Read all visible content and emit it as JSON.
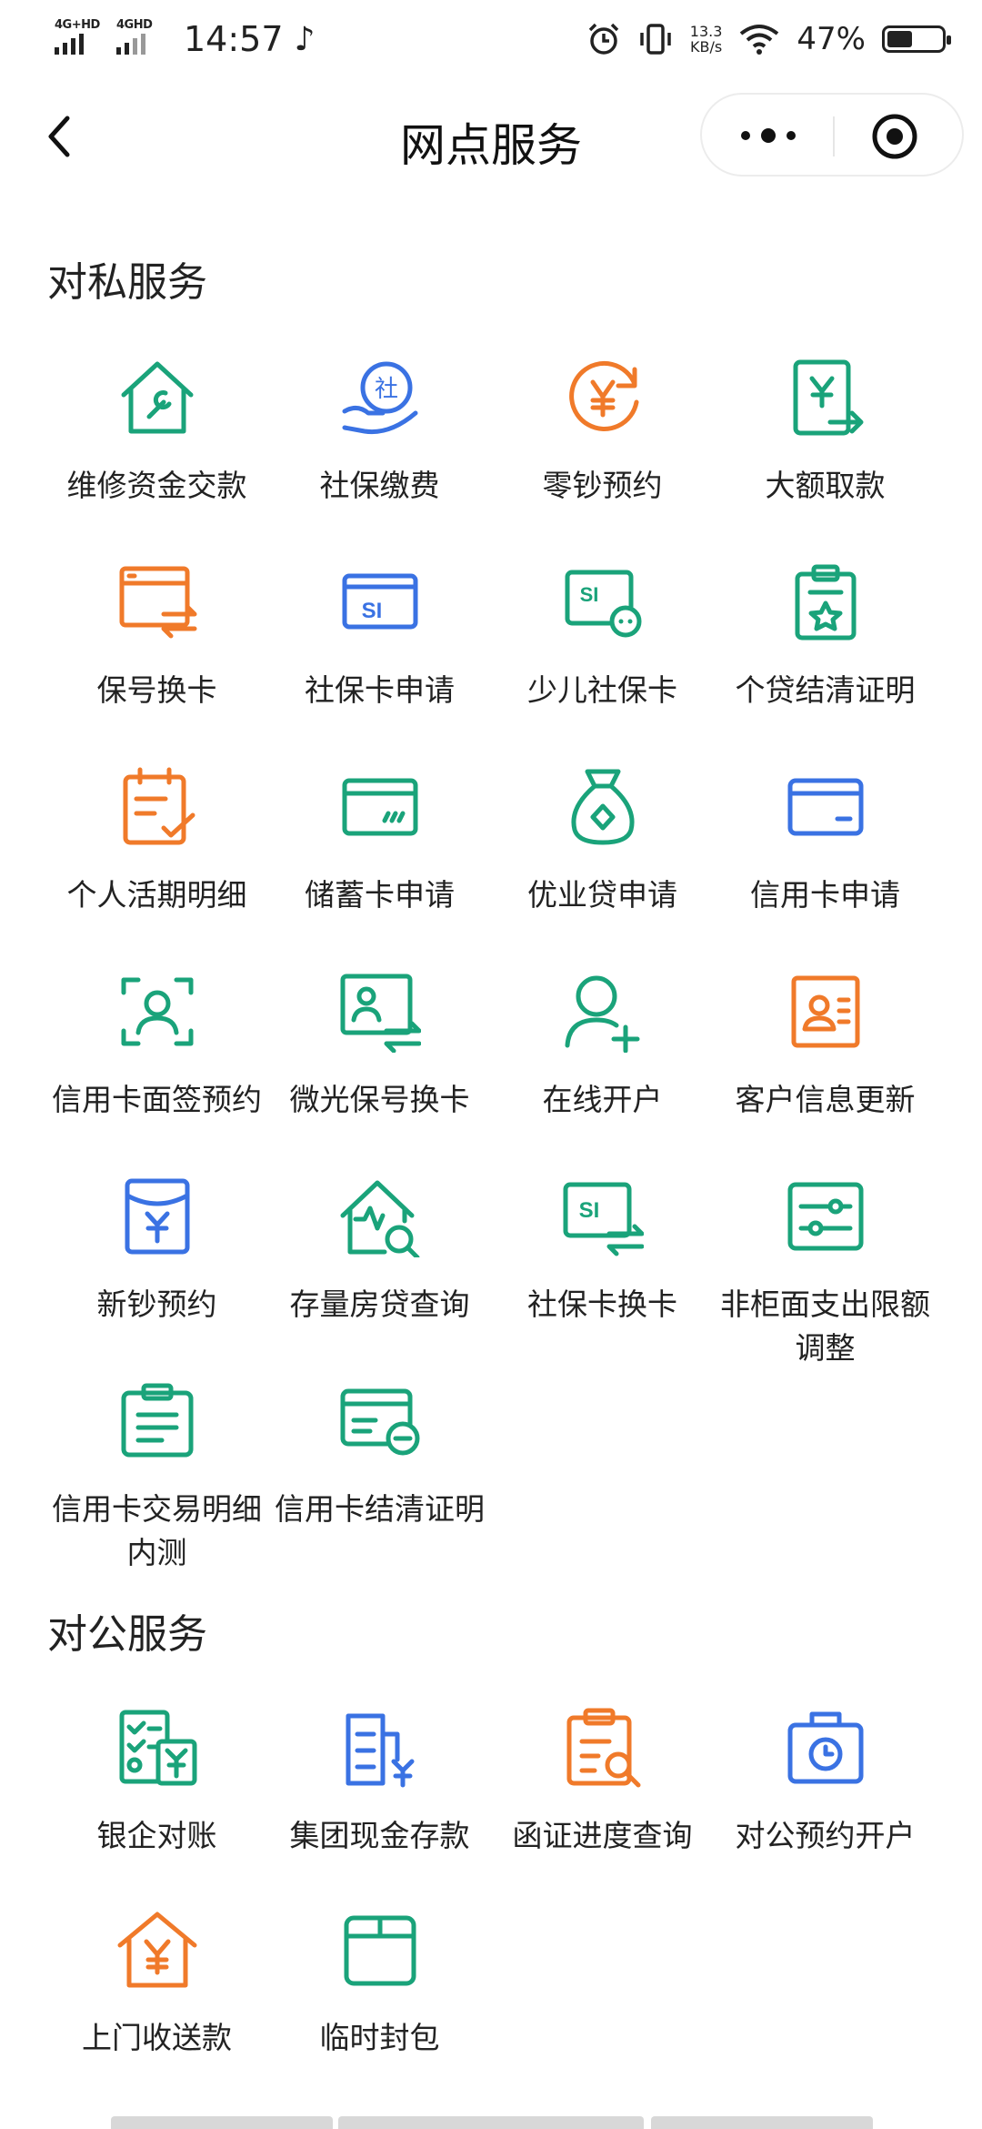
{
  "status_bar": {
    "network1": "4G+HD",
    "network2": "4GHD",
    "time": "14:57",
    "speed_value": "13.3",
    "speed_unit": "KB/s",
    "battery": "47%",
    "battery_level": 0.47
  },
  "header": {
    "title": "网点服务"
  },
  "personal": {
    "title": "对私服务",
    "items": [
      {
        "label": "维修资金交款",
        "icon": "house-wrench-icon",
        "color": "#1aa37a"
      },
      {
        "label": "社保缴费",
        "icon": "hand-social-icon",
        "color": "#3a72e3"
      },
      {
        "label": "零钞预约",
        "icon": "yuan-refresh-icon",
        "color": "#f07a2a"
      },
      {
        "label": "大额取款",
        "icon": "yuan-withdraw-icon",
        "color": "#1aa37a"
      },
      {
        "label": "保号换卡",
        "icon": "window-swap-icon",
        "color": "#f07a2a"
      },
      {
        "label": "社保卡申请",
        "icon": "si-card-icon",
        "color": "#3a72e3"
      },
      {
        "label": "少儿社保卡",
        "icon": "si-card-child-icon",
        "color": "#1aa37a"
      },
      {
        "label": "个贷结清证明",
        "icon": "clipboard-star-icon",
        "color": "#1aa37a"
      },
      {
        "label": "个人活期明细",
        "icon": "calendar-check-icon",
        "color": "#f07a2a"
      },
      {
        "label": "储蓄卡申请",
        "icon": "debit-card-icon",
        "color": "#1aa37a"
      },
      {
        "label": "优业贷申请",
        "icon": "money-bag-icon",
        "color": "#1aa37a"
      },
      {
        "label": "信用卡申请",
        "icon": "credit-card-icon",
        "color": "#3a72e3"
      },
      {
        "label": "信用卡面签预约",
        "icon": "face-scan-icon",
        "color": "#1aa37a"
      },
      {
        "label": "微光保号换卡",
        "icon": "person-card-swap-icon",
        "color": "#1aa37a"
      },
      {
        "label": "在线开户",
        "icon": "add-user-icon",
        "color": "#1aa37a"
      },
      {
        "label": "客户信息更新",
        "icon": "contact-card-icon",
        "color": "#f07a2a"
      },
      {
        "label": "新钞预约",
        "icon": "yuan-envelope-icon",
        "color": "#3a72e3"
      },
      {
        "label": "存量房贷查询",
        "icon": "house-search-icon",
        "color": "#1aa37a"
      },
      {
        "label": "社保卡换卡",
        "icon": "si-card-swap-icon",
        "color": "#1aa37a"
      },
      {
        "label": "非柜面支出限额调整",
        "icon": "sliders-icon",
        "color": "#1aa37a"
      },
      {
        "label": "信用卡交易明细内测",
        "icon": "clipboard-lines-icon",
        "color": "#1aa37a"
      },
      {
        "label": "信用卡结清证明",
        "icon": "card-minus-icon",
        "color": "#1aa37a"
      }
    ]
  },
  "corporate": {
    "title": "对公服务",
    "items": [
      {
        "label": "银企对账",
        "icon": "checklist-yuan-icon",
        "color": "#1aa37a"
      },
      {
        "label": "集团现金存款",
        "icon": "building-yuan-icon",
        "color": "#3a72e3"
      },
      {
        "label": "函证进度查询",
        "icon": "clipboard-search-icon",
        "color": "#f07a2a"
      },
      {
        "label": "对公预约开户",
        "icon": "bag-clock-icon",
        "color": "#3a72e3"
      },
      {
        "label": "上门收送款",
        "icon": "house-yuan-icon",
        "color": "#f07a2a"
      },
      {
        "label": "临时封包",
        "icon": "package-icon",
        "color": "#1aa37a"
      }
    ]
  }
}
